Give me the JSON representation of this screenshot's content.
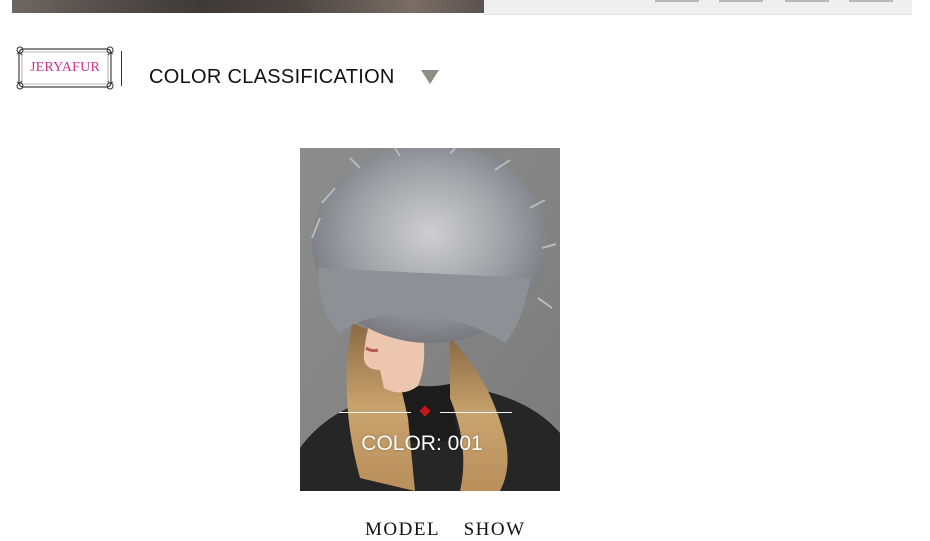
{
  "logo": {
    "text": "JERYAFUR",
    "color": "#d0308a"
  },
  "header": {
    "title": "COLOR CLASSIFICATION",
    "arrow_icon": "triangle-down-icon",
    "arrow_color": "#8e8e85"
  },
  "product": {
    "color_label": "COLOR: 001",
    "accent": "#c4161c"
  },
  "next_section": {
    "title": "MODEL SHOW"
  }
}
